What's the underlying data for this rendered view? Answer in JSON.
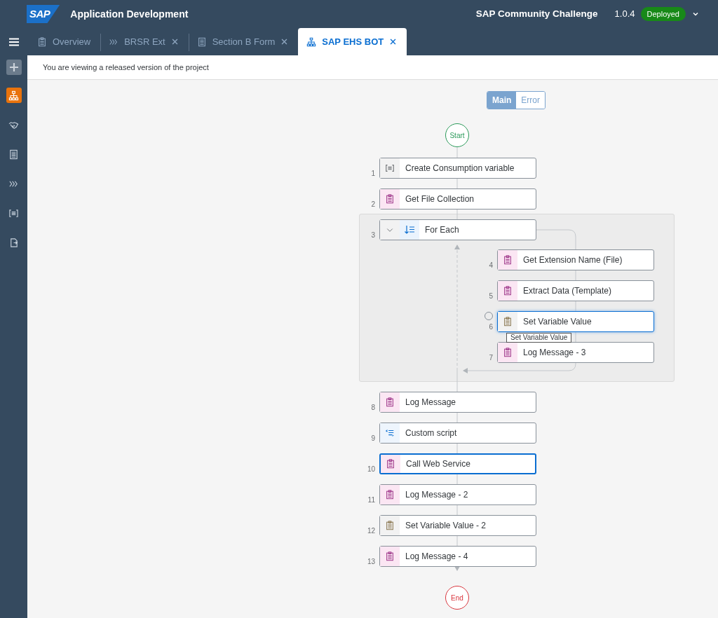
{
  "header": {
    "logo": "SAP",
    "title": "Application Development",
    "project": "SAP Community Challenge",
    "version": "1.0.4",
    "status": "Deployed"
  },
  "tabs": [
    {
      "label": "Overview",
      "closable": false,
      "selected": false
    },
    {
      "label": "BRSR Ext",
      "closable": true,
      "selected": false
    },
    {
      "label": "Section B Form",
      "closable": true,
      "selected": false
    },
    {
      "label": "SAP EHS BOT",
      "closable": true,
      "selected": true
    }
  ],
  "sidebar": {
    "items": [
      {
        "selected": true
      },
      {
        "selected": false
      },
      {
        "selected": false
      },
      {
        "selected": false
      },
      {
        "selected": false
      },
      {
        "selected": false
      }
    ]
  },
  "message": "You are viewing a released version of the project",
  "views": [
    {
      "label": "Main",
      "selected": true
    },
    {
      "label": "Error",
      "selected": false
    }
  ],
  "flow": {
    "start": "Start",
    "end": "End",
    "steps": [
      {
        "number": "1",
        "label": "Create Consumption variable",
        "kind": "variable",
        "selected": false,
        "hovered": false
      },
      {
        "number": "2",
        "label": "Get File Collection",
        "kind": "activity",
        "selected": false,
        "hovered": false
      },
      {
        "number": "3",
        "label": "For Each",
        "kind": "loop",
        "expanded": true,
        "selected": false,
        "hovered": false,
        "children": [
          {
            "number": "4",
            "label": "Get Extension Name (File)",
            "kind": "activity",
            "selected": false,
            "hovered": false
          },
          {
            "number": "5",
            "label": "Extract Data (Template)",
            "kind": "activity",
            "selected": false,
            "hovered": false
          },
          {
            "number": "6",
            "label": "Set Variable Value",
            "kind": "setvar",
            "selected": false,
            "hovered": true,
            "tooltip": "Set Variable Value"
          },
          {
            "number": "7",
            "label": "Log Message - 3",
            "kind": "activity",
            "selected": false,
            "hovered": false
          }
        ]
      },
      {
        "number": "8",
        "label": "Log Message",
        "kind": "activity",
        "selected": false,
        "hovered": false
      },
      {
        "number": "9",
        "label": "Custom script",
        "kind": "script",
        "selected": false,
        "hovered": false
      },
      {
        "number": "10",
        "label": "Call Web Service",
        "kind": "activity",
        "selected": true,
        "hovered": false
      },
      {
        "number": "11",
        "label": "Log Message - 2",
        "kind": "activity",
        "selected": false,
        "hovered": false
      },
      {
        "number": "12",
        "label": "Set Variable Value - 2",
        "kind": "setvar",
        "selected": false,
        "hovered": false
      },
      {
        "number": "13",
        "label": "Log Message - 4",
        "kind": "activity",
        "selected": false,
        "hovered": false
      }
    ]
  }
}
